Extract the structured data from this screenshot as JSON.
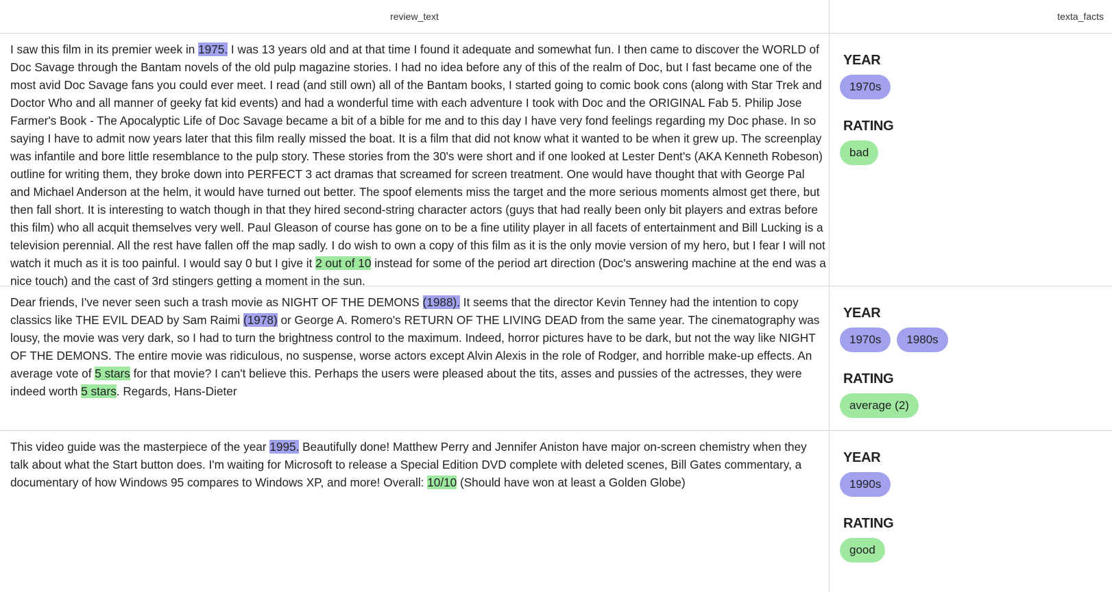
{
  "columns": {
    "review": "review_text",
    "facts": "texta_facts"
  },
  "labels": {
    "year": "YEAR",
    "rating": "RATING"
  },
  "colors": {
    "year_highlight": "#a2a1ee",
    "rating_highlight": "#9ee8a0"
  },
  "rows": [
    {
      "segments": [
        {
          "t": "I saw this film in its premier week in "
        },
        {
          "t": "1975.",
          "hl": "year"
        },
        {
          "t": " I was 13 years old and at that time I found it adequate and somewhat fun. I then came to discover the WORLD of Doc Savage through the Bantam novels of the old pulp magazine stories. I had no idea before any of this of the realm of Doc, but I fast became one of the most avid Doc Savage fans you could ever meet. I read (and still own) all of the Bantam books, I started going to comic book cons (along with Star Trek and Doctor Who and all manner of geeky fat kid events) and had a wonderful time with each adventure I took with Doc and the ORIGINAL Fab 5. Philip Jose Farmer's Book - The Apocalyptic Life of Doc Savage became a bit of a bible for me and to this day I have very fond feelings regarding my Doc phase. In so saying I have to admit now years later that this film really missed the boat. It is a film that did not know what it wanted to be when it grew up. The screenplay was infantile and bore little resemblance to the pulp story. These stories from the 30's were short and if one looked at Lester Dent's (AKA Kenneth Robeson) outline for writing them, they broke down into PERFECT 3 act dramas that screamed for screen treatment. One would have thought that with George Pal and Michael Anderson at the helm, it would have turned out better. The spoof elements miss the target and the more serious moments almost get there, but then fall short. It is interesting to watch though in that they hired second-string character actors (guys that had really been only bit players and extras before this film) who all acquit themselves very well. Paul Gleason of course has gone on to be a fine utility player in all facets of entertainment and Bill Lucking is a television perennial. All the rest have fallen off the map sadly. I do wish to own a copy of this film as it is the only movie version of my hero, but I fear I will not watch it much as it is too painful. I would say 0 but I give it "
        },
        {
          "t": "2 out of 10",
          "hl": "rating"
        },
        {
          "t": " instead for some of the period art direction (Doc's answering machine at the end was a nice touch) and the cast of 3rd stingers getting a moment in the sun."
        }
      ],
      "year": [
        "1970s"
      ],
      "rating": [
        "bad"
      ]
    },
    {
      "segments": [
        {
          "t": "Dear friends, I've never seen such a trash movie as NIGHT OF THE DEMONS "
        },
        {
          "t": "(1988).",
          "hl": "year"
        },
        {
          "t": " It seems that the director Kevin Tenney had the intention to copy classics like THE EVIL DEAD by Sam Raimi "
        },
        {
          "t": "(1978)",
          "hl": "year"
        },
        {
          "t": " or George A. Romero's RETURN OF THE LIVING DEAD from the same year. The cinematography was lousy, the movie was very dark, so I had to turn the brightness control to the maximum. Indeed, horror pictures have to be dark, but not the way like NIGHT OF THE DEMONS. The entire movie was ridiculous, no suspense, worse actors except Alvin Alexis in the role of Rodger, and horrible make-up effects. An average vote of "
        },
        {
          "t": "5 stars",
          "hl": "rating"
        },
        {
          "t": " for that movie? I can't believe this. Perhaps the users were pleased about the tits, asses and pussies of the actresses, they were indeed worth "
        },
        {
          "t": "5 stars",
          "hl": "rating"
        },
        {
          "t": ". Regards, Hans-Dieter"
        }
      ],
      "year": [
        "1970s",
        "1980s"
      ],
      "rating": [
        "average (2)"
      ]
    },
    {
      "segments": [
        {
          "t": "This video guide was the masterpiece of the year "
        },
        {
          "t": "1995.",
          "hl": "year"
        },
        {
          "t": " Beautifully done! Matthew Perry and Jennifer Aniston have major on-screen chemistry when they talk about what the Start button does. I'm waiting for Microsoft to release a Special Edition DVD complete with deleted scenes, Bill Gates commentary, a documentary of how Windows 95 compares to Windows XP, and more! Overall: "
        },
        {
          "t": "10/10",
          "hl": "rating"
        },
        {
          "t": " (Should have won at least a Golden Globe)"
        }
      ],
      "year": [
        "1990s"
      ],
      "rating": [
        "good"
      ]
    }
  ]
}
